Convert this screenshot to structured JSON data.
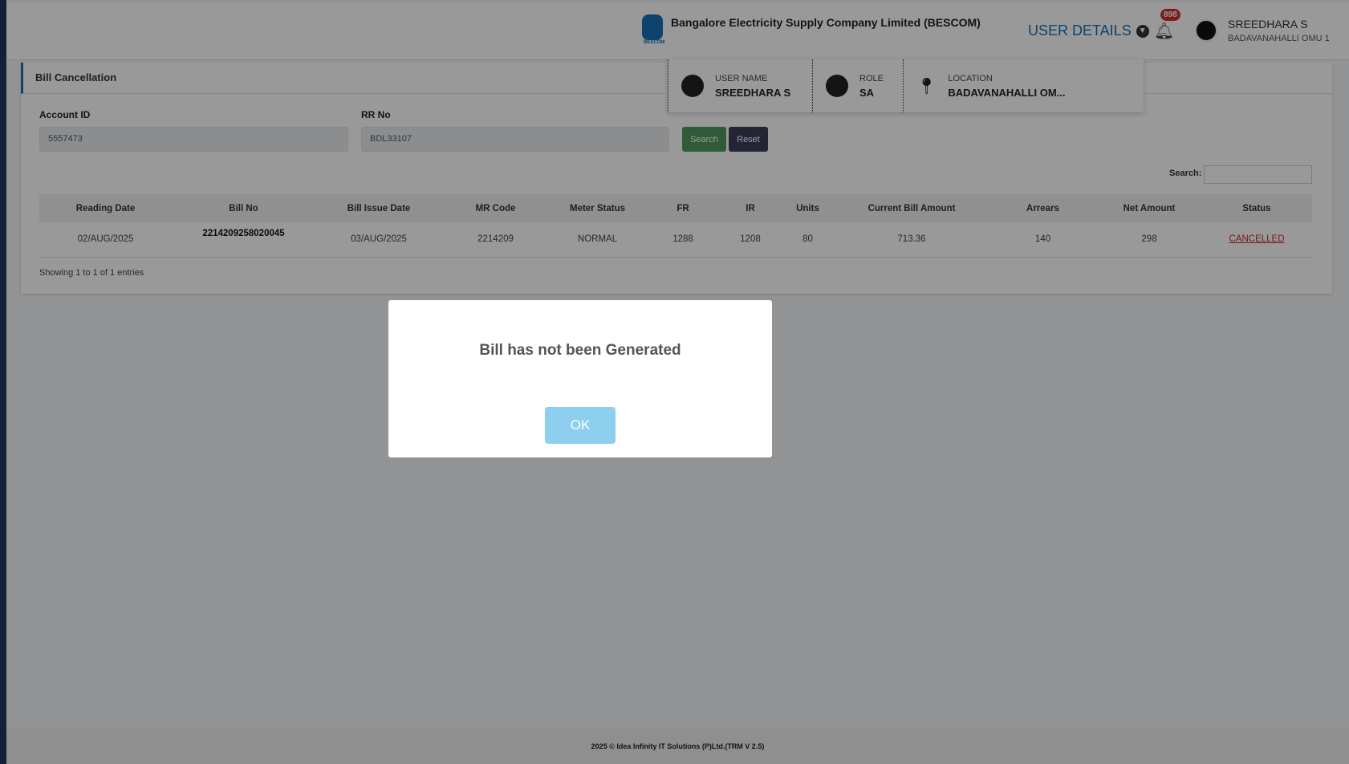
{
  "header": {
    "company": "Bangalore Electricity Supply Company Limited (BESCOM)",
    "user_details": "USER DETAILS",
    "notifications": "898",
    "user_name": "SREEDHARA S",
    "user_location": "BADAVANAHALLI OMU 1"
  },
  "user_dropdown": {
    "user_name_label": "USER NAME",
    "user_name": "SREEDHARA S",
    "role_label": "ROLE",
    "role": "SA",
    "location_label": "LOCATION",
    "location": "BADAVANAHALLI OM..."
  },
  "page": {
    "title": "Bill Cancellation",
    "account_label": "Account ID",
    "account_value": "5557473",
    "rr_label": "RR No",
    "rr_value": "BDL33107",
    "search_button": "Search",
    "reset_button": "Reset",
    "table_search_label": "Search:",
    "showing": "Showing 1 to 1 of 1 entries"
  },
  "table": {
    "columns": [
      "Reading Date",
      "Bill No",
      "Bill Issue Date",
      "MR Code",
      "Meter Status",
      "FR",
      "IR",
      "Units",
      "Current Bill Amount",
      "Arrears",
      "Net Amount",
      "Status"
    ],
    "rows": [
      [
        "02/AUG/2025",
        "2214209258020045",
        "03/AUG/2025",
        "2214209",
        "NORMAL",
        "1288",
        "1208",
        "80",
        "713.36",
        "140",
        "298",
        "CANCELLED"
      ]
    ]
  },
  "modal": {
    "message": "Bill has not been Generated",
    "ok": "OK"
  },
  "footer": "2025 © Idea Infinity IT Solutions (P)Ltd.(TRM V 2.5)",
  "colors": {
    "accent": "#1671b4",
    "search": "#4f9a5a",
    "reset": "#3c3f58",
    "cancelled": "#c62828",
    "ok": "#8ecff0"
  }
}
